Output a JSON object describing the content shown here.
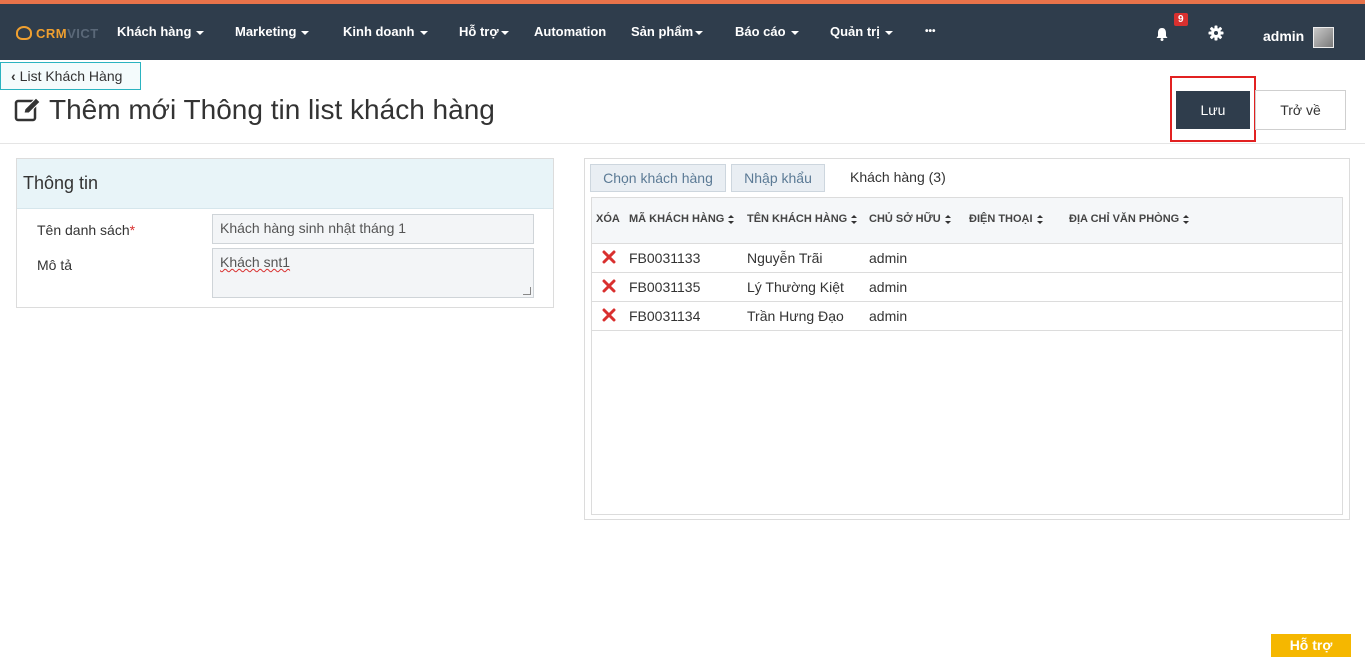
{
  "app": {
    "logo": {
      "brand_main": "CRM",
      "brand_sub": "VICT"
    },
    "nav": [
      {
        "label": "Khách hàng",
        "caret": true
      },
      {
        "label": "Marketing",
        "caret": true
      },
      {
        "label": "Kinh doanh",
        "caret": true
      },
      {
        "label": "Hỗ trợ",
        "caret": true
      },
      {
        "label": "Automation",
        "caret": false
      },
      {
        "label": "Sản phẩm",
        "caret": true
      },
      {
        "label": "Báo cáo",
        "caret": true
      },
      {
        "label": "Quản trị",
        "caret": true
      },
      {
        "label": "•••",
        "caret": false
      }
    ],
    "notifications": {
      "count": "9",
      "icon": "bell-icon"
    },
    "settings_icon": "gear-icon",
    "user": {
      "name": "admin"
    }
  },
  "header": {
    "back_label": "List Khách Hàng",
    "title": "Thêm mới Thông tin list khách hàng",
    "save_label": "Lưu",
    "return_label": "Trở về"
  },
  "info_panel": {
    "title": "Thông tin",
    "list_name_label": "Tên danh sách",
    "list_name_value": "Khách hàng sinh nhật tháng 1",
    "desc_label": "Mô tả",
    "desc_value": "Khách snt1"
  },
  "customers_panel": {
    "tabs": {
      "choose": "Chọn khách hàng",
      "import": "Nhập khẩu",
      "count_label": "Khách hàng (3)"
    },
    "columns": [
      "XÓA",
      "MÃ KHÁCH HÀNG",
      "TÊN KHÁCH HÀNG",
      "CHỦ SỞ HỮU",
      "ĐIỆN THOẠI",
      "ĐỊA CHỈ VĂN PHÒNG"
    ],
    "rows": [
      {
        "code": "FB0031133",
        "name": "Nguyễn Trãi",
        "owner": "admin",
        "phone": "",
        "address": ""
      },
      {
        "code": "FB0031135",
        "name": "Lý Thường Kiệt",
        "owner": "admin",
        "phone": "",
        "address": ""
      },
      {
        "code": "FB0031134",
        "name": "Trần Hưng Đạo",
        "owner": "admin",
        "phone": "",
        "address": ""
      }
    ]
  },
  "help_label": "Hỗ trợ",
  "colors": {
    "navbar": "#2f3d4c",
    "accent_top": "#e8734a",
    "save_highlight": "#e22121",
    "help": "#f5b700",
    "delete": "#d9302f"
  }
}
